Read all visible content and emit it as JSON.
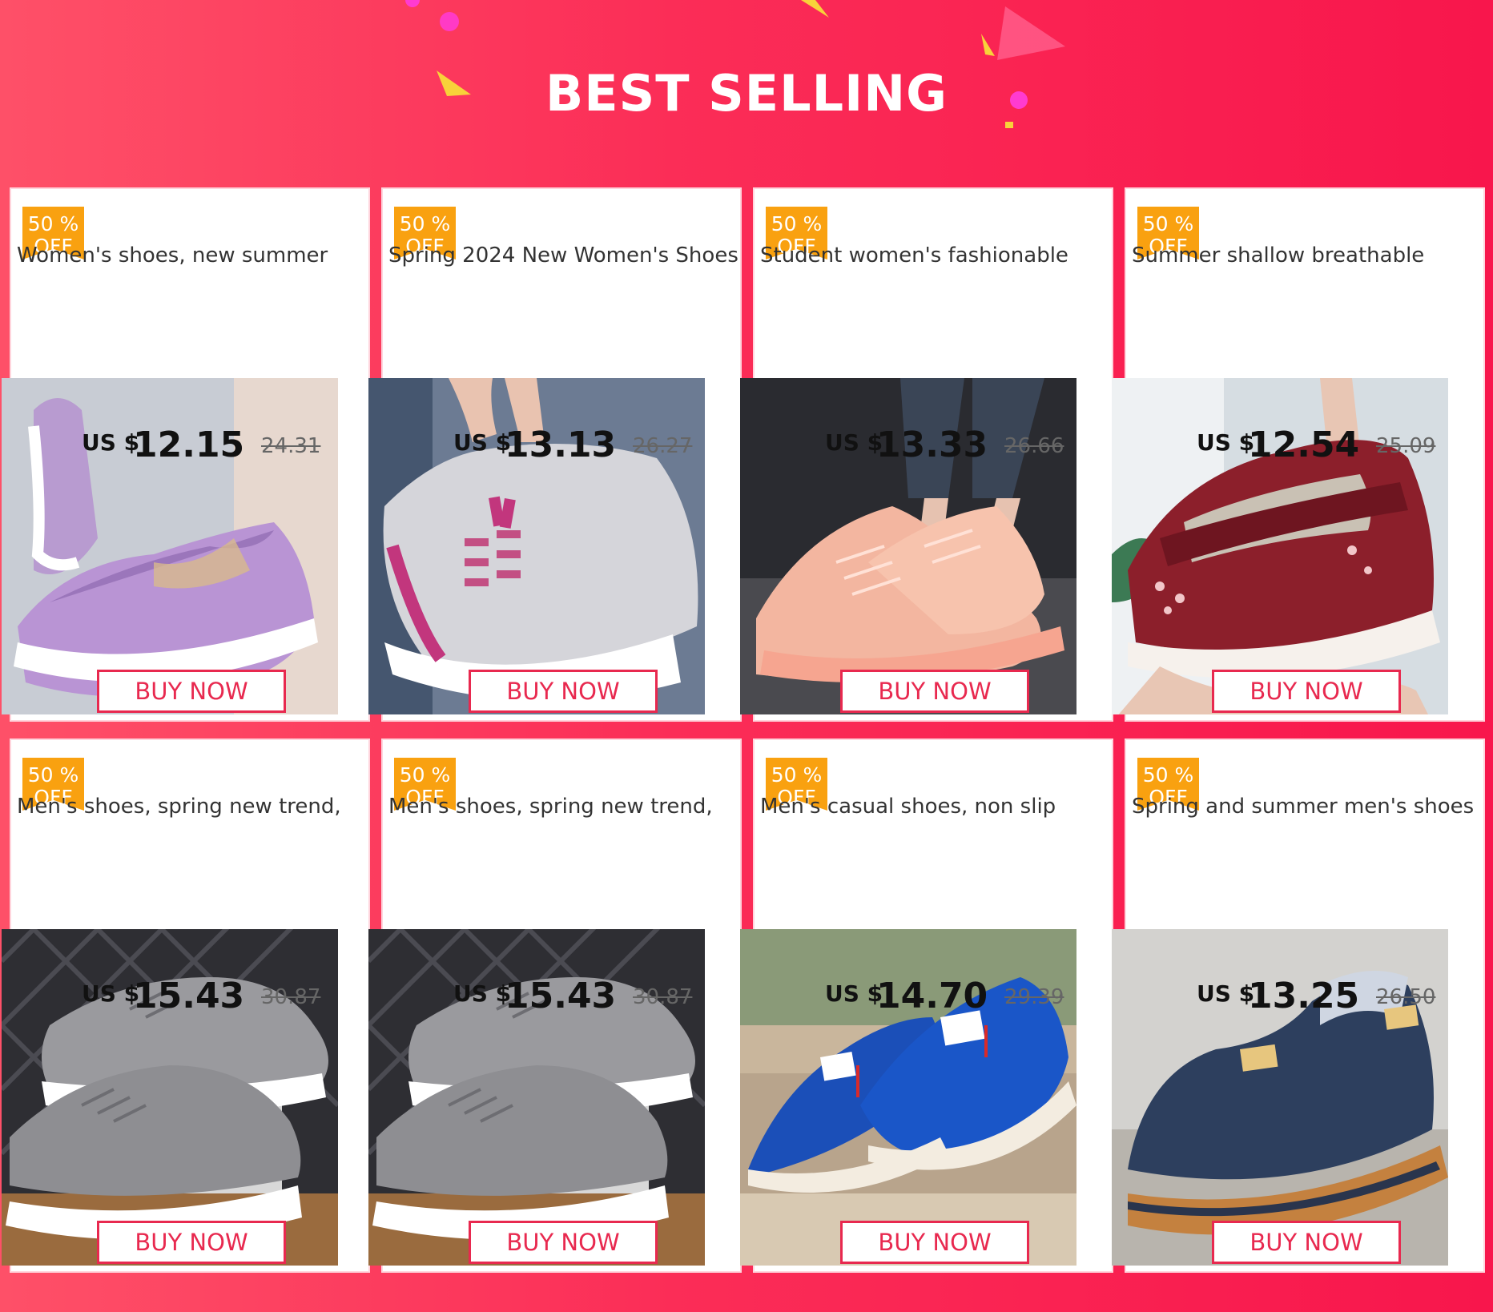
{
  "banner": {
    "title": "BEST SELLING"
  },
  "colors": {
    "brand_red": "#f8164c",
    "badge_orange": "#f9a110",
    "button_red": "#e8294f"
  },
  "products": [
    {
      "badge_pct": "50 %",
      "badge_off": "OFF",
      "title": "Women's shoes, new summer",
      "currency": "US $",
      "price": "12.15",
      "old_price": "24.31",
      "button": "BUY NOW",
      "image": "purple-knit-slip-on"
    },
    {
      "badge_pct": "50 %",
      "badge_off": "OFF",
      "title": "Spring 2024 New Women's Shoes",
      "currency": "US $",
      "price": "13.13",
      "old_price": "26.27",
      "button": "BUY NOW",
      "image": "grey-bunny-sneaker"
    },
    {
      "badge_pct": "50 %",
      "badge_off": "OFF",
      "title": "Student women's fashionable",
      "currency": "US $",
      "price": "13.33",
      "old_price": "26.66",
      "button": "BUY NOW",
      "image": "pink-lace-sneaker"
    },
    {
      "badge_pct": "50 %",
      "badge_off": "OFF",
      "title": "Summer shallow breathable",
      "currency": "US $",
      "price": "12.54",
      "old_price": "25.09",
      "button": "BUY NOW",
      "image": "burgundy-mary-jane"
    },
    {
      "badge_pct": "50 %",
      "badge_off": "OFF",
      "title": "Men's shoes, spring new trend,",
      "currency": "US $",
      "price": "15.43",
      "old_price": "30.87",
      "button": "BUY NOW",
      "image": "grey-runner-sneaker"
    },
    {
      "badge_pct": "50 %",
      "badge_off": "OFF",
      "title": "Men's shoes, spring new trend,",
      "currency": "US $",
      "price": "15.43",
      "old_price": "30.87",
      "button": "BUY NOW",
      "image": "grey-runner-sneaker"
    },
    {
      "badge_pct": "50 %",
      "badge_off": "OFF",
      "title": "Men's casual shoes, non slip",
      "currency": "US $",
      "price": "14.70",
      "old_price": "29.39",
      "button": "BUY NOW",
      "image": "blue-canvas-loafer"
    },
    {
      "badge_pct": "50 %",
      "badge_off": "OFF",
      "title": "Spring and summer men's shoes",
      "currency": "US $",
      "price": "13.25",
      "old_price": "26.50",
      "button": "BUY NOW",
      "image": "navy-canvas-loafer"
    }
  ]
}
